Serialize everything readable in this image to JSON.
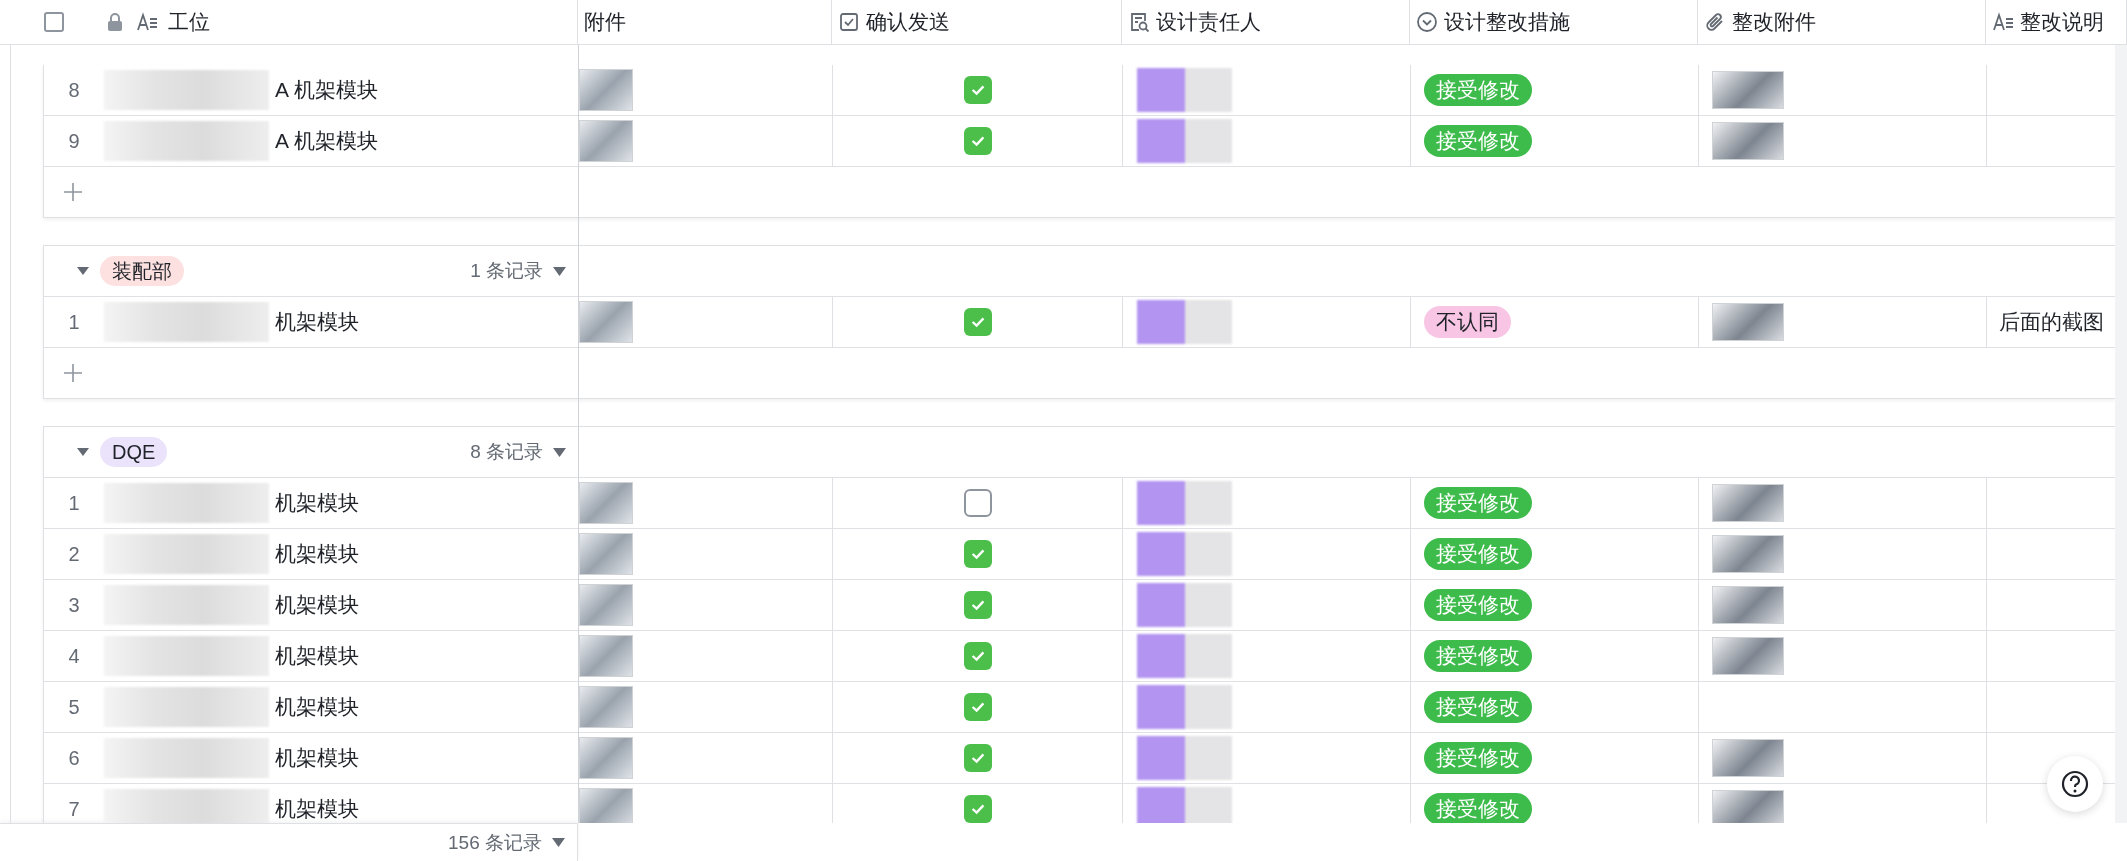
{
  "header": {
    "select_all": {
      "checked": false
    },
    "columns": [
      {
        "kind": "text",
        "label": "工位",
        "locked": true
      },
      {
        "kind": "plain",
        "label": "附件",
        "locked": false
      },
      {
        "kind": "checkbox",
        "label": "确认发送",
        "locked": false
      },
      {
        "kind": "lookup",
        "label": "设计责任人",
        "locked": false
      },
      {
        "kind": "select",
        "label": "设计整改措施",
        "locked": false
      },
      {
        "kind": "attachment",
        "label": "整改附件",
        "locked": false
      },
      {
        "kind": "text",
        "label": "整改说明",
        "locked": false
      }
    ]
  },
  "groups": [
    {
      "rows": [
        {
          "number": "8",
          "name": "A 机架模块",
          "attachment": true,
          "confirmed": true,
          "measure": {
            "label": "接受修改",
            "color": "#3dbb4b"
          },
          "fix_attachment": true
        },
        {
          "number": "9",
          "name": "A 机架模块",
          "attachment": true,
          "confirmed": true,
          "measure": {
            "label": "接受修改",
            "color": "#3dbb4b"
          },
          "fix_attachment": true
        }
      ]
    },
    {
      "tag": {
        "label": "装配部",
        "color": "#fde1e1"
      },
      "count": "1 条记录",
      "expanded": true,
      "rows": [
        {
          "number": "1",
          "name": "机架模块",
          "attachment": true,
          "confirmed": true,
          "measure": {
            "label": "不认同",
            "color": "#f8c6e4"
          },
          "fix_attachment": true,
          "note": "后面的截图"
        }
      ]
    },
    {
      "tag": {
        "label": "DQE",
        "color": "#ebe3fb"
      },
      "count": "8 条记录",
      "expanded": true,
      "rows": [
        {
          "number": "1",
          "name": "机架模块",
          "attachment": true,
          "confirmed": false,
          "measure": {
            "label": "接受修改",
            "color": "#3dbb4b"
          },
          "fix_attachment": true
        },
        {
          "number": "2",
          "name": "机架模块",
          "attachment": true,
          "confirmed": true,
          "measure": {
            "label": "接受修改",
            "color": "#3dbb4b"
          },
          "fix_attachment": true
        },
        {
          "number": "3",
          "name": "机架模块",
          "attachment": true,
          "confirmed": true,
          "measure": {
            "label": "接受修改",
            "color": "#3dbb4b"
          },
          "fix_attachment": true
        },
        {
          "number": "4",
          "name": "机架模块",
          "attachment": true,
          "confirmed": true,
          "measure": {
            "label": "接受修改",
            "color": "#3dbb4b"
          },
          "fix_attachment": true
        },
        {
          "number": "5",
          "name": "机架模块",
          "attachment": true,
          "confirmed": true,
          "measure": {
            "label": "接受修改",
            "color": "#3dbb4b"
          },
          "fix_attachment": false
        },
        {
          "number": "6",
          "name": "机架模块",
          "attachment": true,
          "confirmed": true,
          "measure": {
            "label": "接受修改",
            "color": "#3dbb4b"
          },
          "fix_attachment": true
        },
        {
          "number": "7",
          "name": "机架模块",
          "attachment": true,
          "confirmed": true,
          "measure": {
            "label": "接受修改",
            "color": "#3dbb4b"
          },
          "fix_attachment": true
        }
      ]
    }
  ],
  "footer": {
    "total": "156 条记录"
  }
}
